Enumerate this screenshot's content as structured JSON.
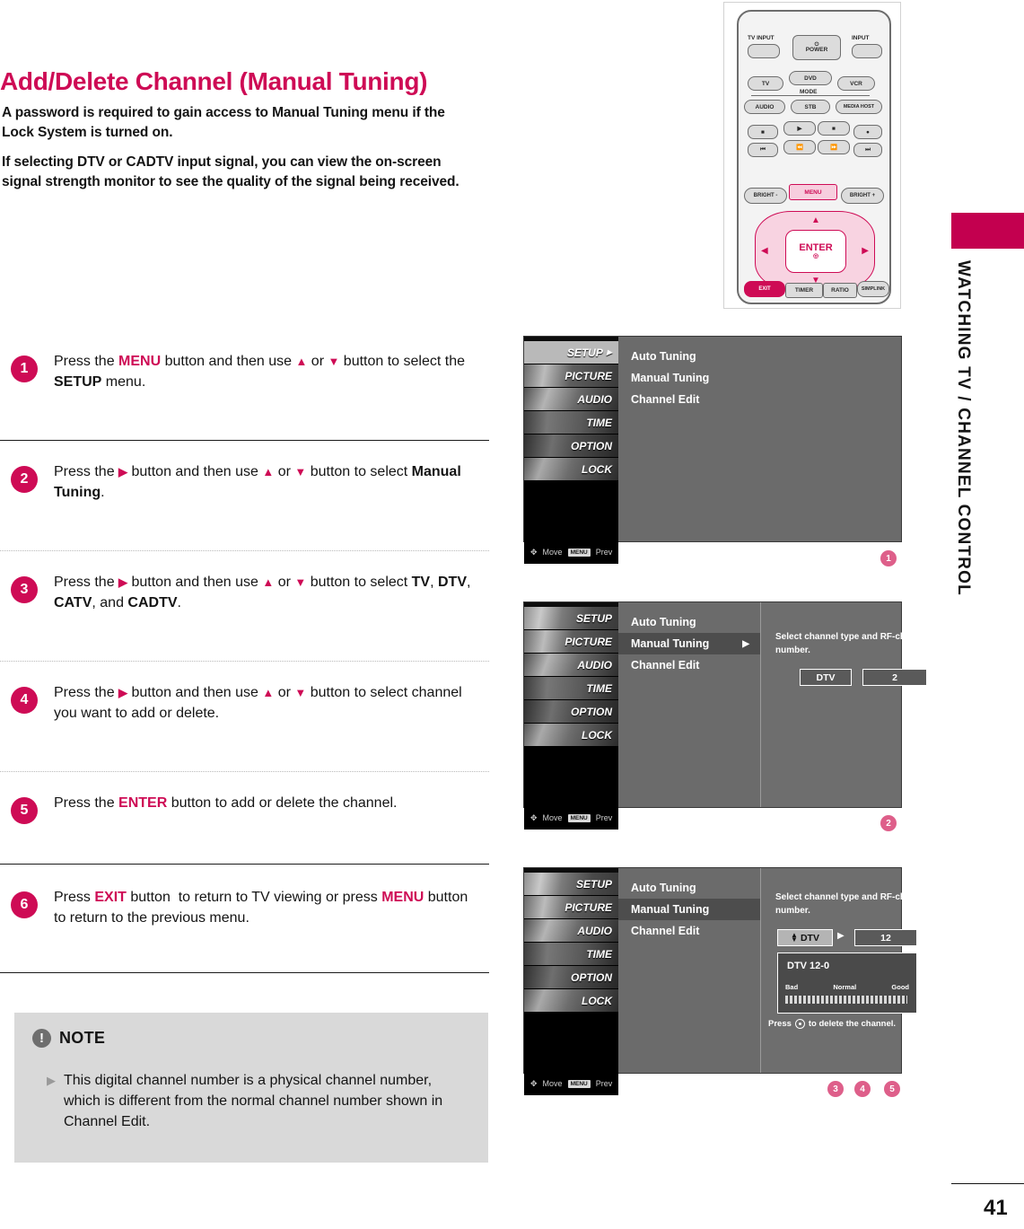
{
  "page": {
    "title": "Add/Delete Channel (Manual Tuning)",
    "number": "41",
    "side_tab_label": "WATCHING TV / CHANNEL CONTROL",
    "accent_color": "#ce0b55",
    "marker_color": "#de5f8a"
  },
  "intro": {
    "paragraph1": "A password is required to gain access to Manual Tuning menu if the Lock System is turned on.",
    "paragraph2": "If selecting DTV or CADTV input signal, you can view the on-screen signal strength monitor to see the quality of the signal being received."
  },
  "steps": [
    {
      "number": "1",
      "html": "Press the <b class=\"kw\">MENU</b> button and then use <b class=\"tri-up\">▲</b> or <b class=\"tri-up\">▼</b> button to select the <b class=\"kwb\">SETUP</b> menu."
    },
    {
      "number": "2",
      "html": "Press the <b class=\"tri-right\">▶</b> button and then use <b class=\"tri-up\">▲</b> or <b class=\"tri-up\">▼</b> button to select <b class=\"kwb\">Manual Tuning</b>."
    },
    {
      "number": "3",
      "html": "Press the <b class=\"tri-right\">▶</b> button and then use <b class=\"tri-up\">▲</b> or <b class=\"tri-up\">▼</b> button to select <b class=\"kwb\">TV</b>, <b class=\"kwb\">DTV</b>, <b class=\"kwb\">CATV</b>, and <b class=\"kwb\">CADTV</b>."
    },
    {
      "number": "4",
      "html": "Press the <b class=\"tri-right\">▶</b> button and then use <b class=\"tri-up\">▲</b> or <b class=\"tri-up\">▼</b> button to select channel you want to add or delete."
    },
    {
      "number": "5",
      "html": "Press the <b class=\"kw\">ENTER</b> button to add or delete the channel."
    },
    {
      "number": "6",
      "html": "Press <b class=\"kw\">EXIT</b> button&nbsp; to return to TV viewing or press <b class=\"kw\">MENU</b> button to return to the previous menu."
    }
  ],
  "note": {
    "title": "NOTE",
    "icon": "exclamation-icon",
    "bullet": "This digital channel number is a physical channel number, which is different from the normal channel number shown in Channel Edit."
  },
  "remote": {
    "labels": {
      "tv_input": "TV INPUT",
      "power": "POWER",
      "input": "INPUT",
      "tv": "TV",
      "dvd": "DVD",
      "vcr": "VCR",
      "mode": "MODE",
      "audio": "AUDIO",
      "stb": "STB",
      "media_host": "MEDIA HOST",
      "bright_minus": "BRIGHT -",
      "menu": "MENU",
      "bright_plus": "BRIGHT +",
      "enter": "ENTER",
      "exit": "EXIT",
      "timer": "TIMER",
      "ratio": "RATIO",
      "simplink": "SIMPLINK"
    }
  },
  "osd": {
    "sidebar": [
      {
        "label": "SETUP",
        "selected": true
      },
      {
        "label": "PICTURE",
        "selected": false
      },
      {
        "label": "AUDIO",
        "selected": false
      },
      {
        "label": "TIME",
        "selected": false
      },
      {
        "label": "OPTION",
        "selected": false
      },
      {
        "label": "LOCK",
        "selected": false
      }
    ],
    "footer": {
      "move": "Move",
      "menu_chip": "MENU",
      "prev": "Prev"
    },
    "menu_items": [
      "Auto Tuning",
      "Manual Tuning",
      "Channel Edit"
    ],
    "help_text": "Select channel type and RF-channel number.",
    "screen1": {
      "marker": "1"
    },
    "screen2": {
      "selected_item": "Manual Tuning",
      "channel_type": "DTV",
      "channel_number": "2",
      "marker": "2"
    },
    "screen3": {
      "selected_item": "Manual Tuning",
      "channel_type": "DTV",
      "channel_number": "12",
      "signal_title": "DTV 12-0",
      "signal_labels": [
        "Bad",
        "Normal",
        "Good"
      ],
      "press_text_before": "Press",
      "press_text_after": "to delete the channel.",
      "markers": [
        "3",
        "4",
        "5"
      ]
    }
  }
}
